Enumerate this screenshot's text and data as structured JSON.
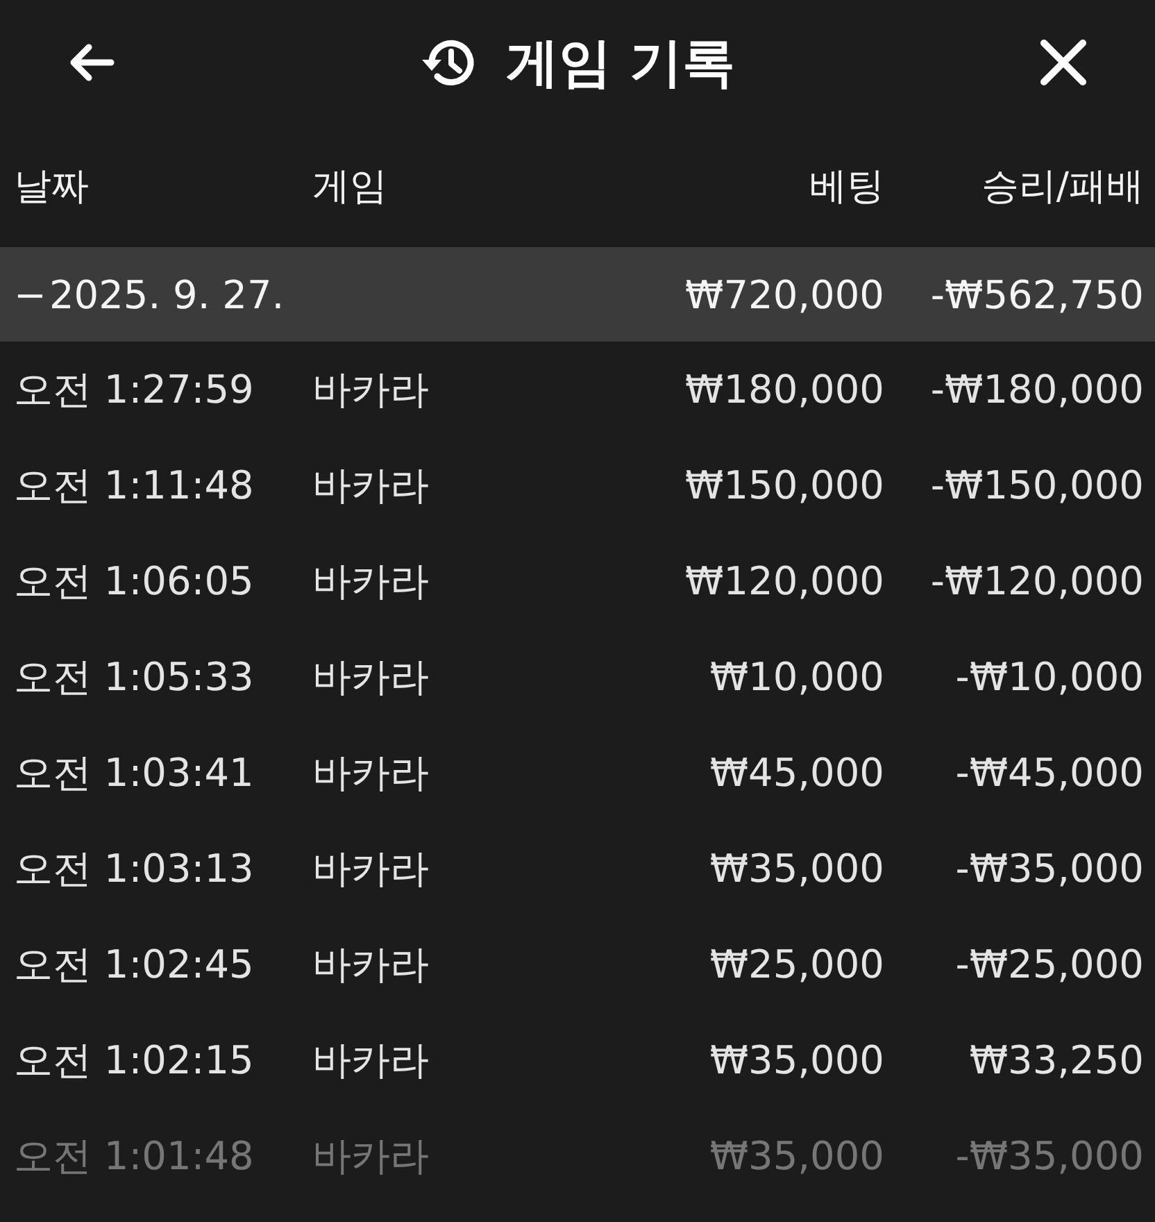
{
  "header": {
    "title": "게임 기록"
  },
  "columns": [
    "날짜",
    "게임",
    "베팅",
    "승리/패배"
  ],
  "groups": [
    {
      "toggle": "−",
      "date": "2025. 9. 27.",
      "bet": "₩720,000",
      "result": "-₩562,750",
      "expanded": true,
      "children": [
        {
          "time": "오전 1:27:59",
          "game": "바카라",
          "bet": "₩180,000",
          "result": "-₩180,000"
        },
        {
          "time": "오전 1:11:48",
          "game": "바카라",
          "bet": "₩150,000",
          "result": "-₩150,000"
        },
        {
          "time": "오전 1:06:05",
          "game": "바카라",
          "bet": "₩120,000",
          "result": "-₩120,000"
        },
        {
          "time": "오전 1:05:33",
          "game": "바카라",
          "bet": "₩10,000",
          "result": "-₩10,000"
        },
        {
          "time": "오전 1:03:41",
          "game": "바카라",
          "bet": "₩45,000",
          "result": "-₩45,000"
        },
        {
          "time": "오전 1:03:13",
          "game": "바카라",
          "bet": "₩35,000",
          "result": "-₩35,000"
        },
        {
          "time": "오전 1:02:45",
          "game": "바카라",
          "bet": "₩25,000",
          "result": "-₩25,000"
        },
        {
          "time": "오전 1:02:15",
          "game": "바카라",
          "bet": "₩35,000",
          "result": "₩33,250"
        },
        {
          "time": "오전 1:01:48",
          "game": "바카라",
          "bet": "₩35,000",
          "result": "-₩35,000"
        }
      ]
    }
  ]
}
